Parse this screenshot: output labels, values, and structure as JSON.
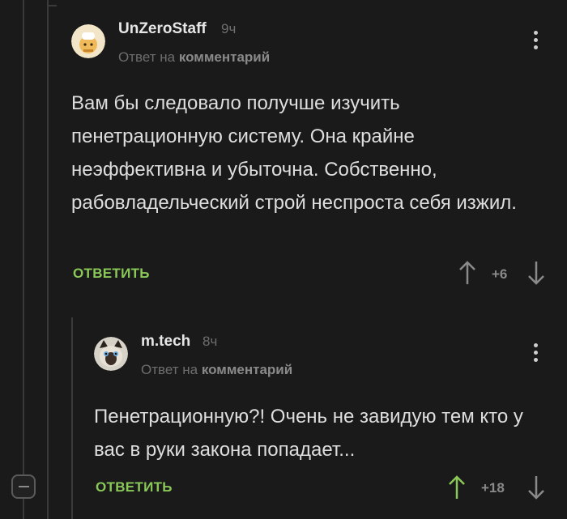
{
  "comments": [
    {
      "author": "UnZeroStaff",
      "time": "9ч",
      "reply_prefix": "Ответ на",
      "reply_target": "комментарий",
      "body": "Вам бы следовало получше изучить пенетрационную систему. Она крайне неэффективна и убыточна. Собственно, рабовладельческий строй неспроста себя изжил.",
      "reply_label": "ОТВЕТИТЬ",
      "score": "+6",
      "upvote_color": "#8a8a8a"
    },
    {
      "author": "m.tech",
      "time": "8ч",
      "reply_prefix": "Ответ на",
      "reply_target": "комментарий",
      "body": "Пенетрационную?! Очень не завидую тем кто у вас в руки закона попадает...",
      "reply_label": "ОТВЕТИТЬ",
      "score": "+18",
      "upvote_color": "#8ac858"
    }
  ],
  "colors": {
    "accent": "#8ac858",
    "background": "#1a1a1a",
    "muted": "#6e6e6e"
  }
}
